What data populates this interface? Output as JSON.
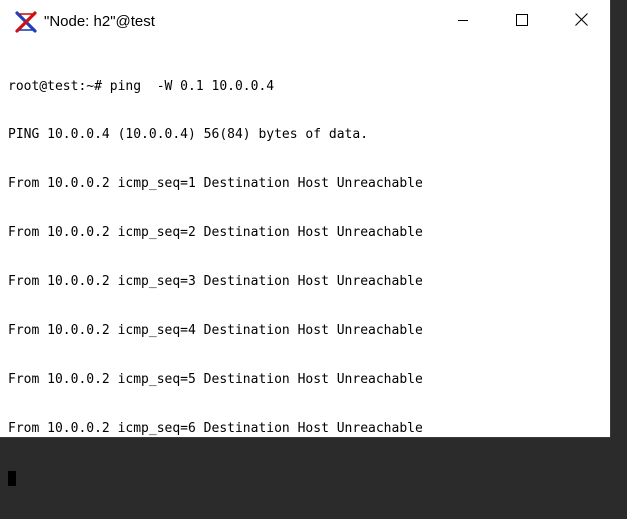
{
  "window": {
    "title": "\"Node: h2\"@test",
    "app_icon": "xterm-x-icon",
    "controls": [
      "minimize-icon",
      "maximize-icon",
      "close-icon"
    ]
  },
  "terminal": {
    "lines": [
      "root@test:~# ping  -W 0.1 10.0.0.4",
      "PING 10.0.0.4 (10.0.0.4) 56(84) bytes of data.",
      "From 10.0.0.2 icmp_seq=1 Destination Host Unreachable",
      "From 10.0.0.2 icmp_seq=2 Destination Host Unreachable",
      "From 10.0.0.2 icmp_seq=3 Destination Host Unreachable",
      "From 10.0.0.2 icmp_seq=4 Destination Host Unreachable",
      "From 10.0.0.2 icmp_seq=5 Destination Host Unreachable",
      "From 10.0.0.2 icmp_seq=6 Destination Host Unreachable"
    ]
  }
}
